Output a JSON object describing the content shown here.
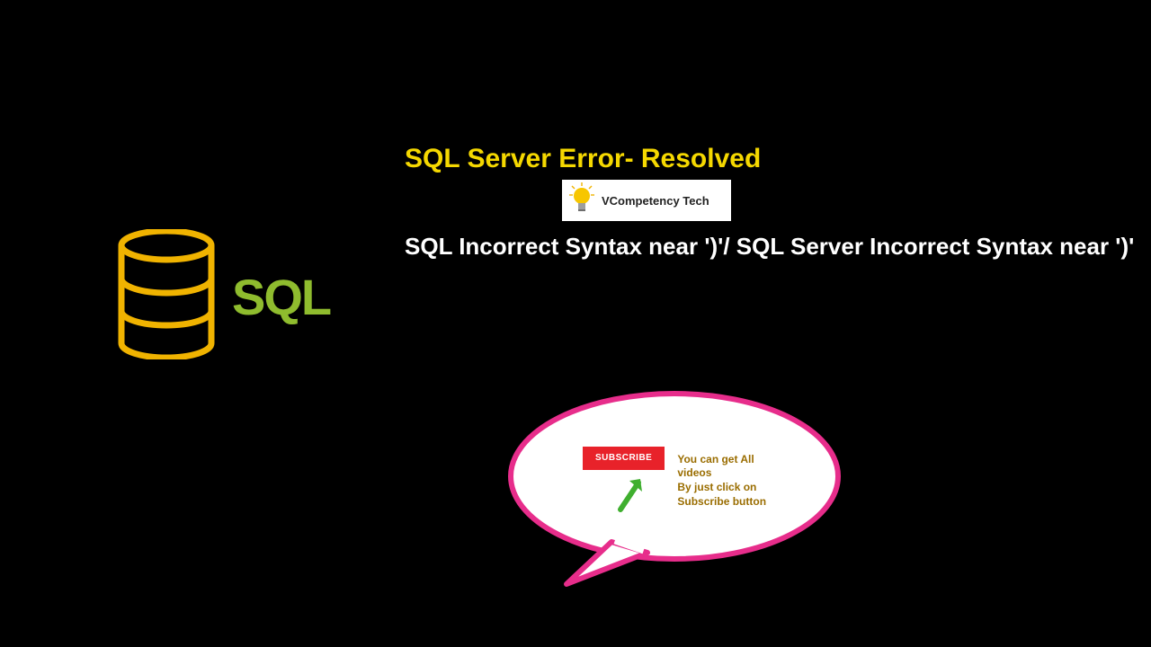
{
  "logo": {
    "text": "SQL"
  },
  "title": "SQL Server Error- Resolved",
  "brand": {
    "name": "VCompetency Tech"
  },
  "subtitle": "SQL   Incorrect Syntax near ')'/ SQL Server Incorrect Syntax near ')'",
  "bubble": {
    "button_label": "SUBSCRIBE",
    "line1": "You can get All",
    "line2": "videos",
    "line3": "By just click on",
    "line4": "Subscribe button"
  }
}
